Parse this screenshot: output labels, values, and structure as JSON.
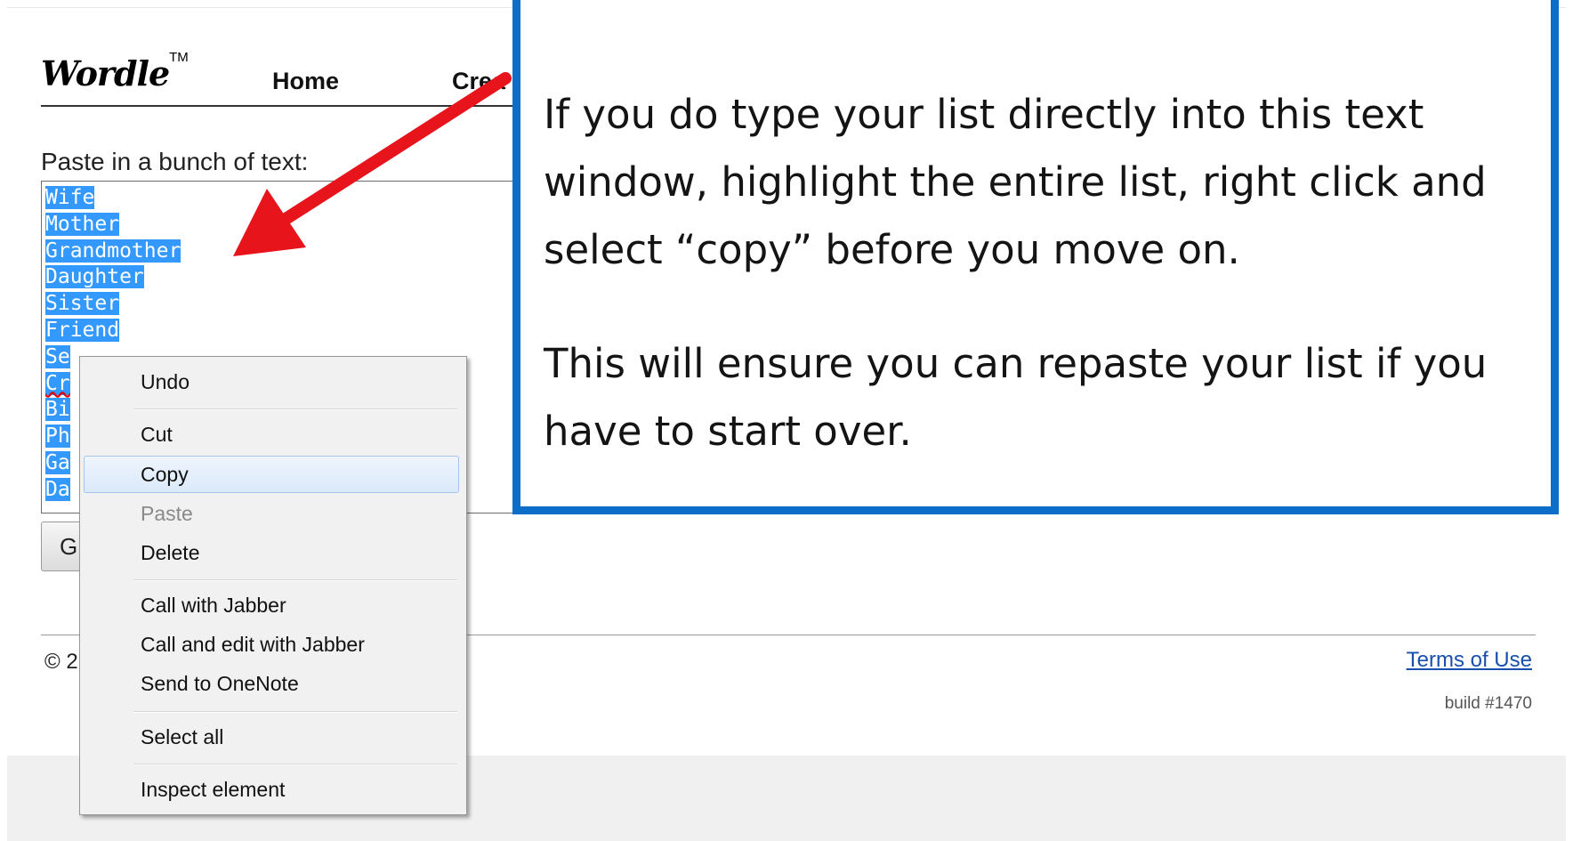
{
  "header": {
    "logo_text": "Wordle",
    "logo_tm": "TM",
    "nav_home": "Home",
    "nav_create": "Crea"
  },
  "form": {
    "paste_label": "Paste in a bunch of text:",
    "text_lines": [
      "Wife",
      "Mother",
      "Grandmother",
      "Daughter",
      "Sister",
      "Friend",
      "Se",
      "Cr",
      "Bi",
      "Ph",
      "Ga",
      "Da"
    ],
    "go_button_label": "G"
  },
  "footer": {
    "copyright": "© 2",
    "terms_link": "Terms of Use",
    "build": "build #1470"
  },
  "callout": {
    "paragraph_1": "If you do type your list directly into this text window, highlight the entire list, right click and select “copy” before you move on.",
    "paragraph_2": "This will ensure you can repaste your list if you have to start over.",
    "border_color": "#0c6ec9"
  },
  "context_menu": {
    "items": [
      {
        "label": "Undo",
        "enabled": true
      },
      {
        "label": "Cut",
        "enabled": true
      },
      {
        "label": "Copy",
        "enabled": true,
        "highlighted": true
      },
      {
        "label": "Paste",
        "enabled": false
      },
      {
        "label": "Delete",
        "enabled": true
      },
      {
        "label": "Call with Jabber",
        "enabled": true
      },
      {
        "label": "Call and edit with Jabber",
        "enabled": true
      },
      {
        "label": "Send to OneNote",
        "enabled": true
      },
      {
        "label": "Select all",
        "enabled": true
      },
      {
        "label": "Inspect element",
        "enabled": true
      }
    ]
  },
  "colors": {
    "selection": "#3399ff",
    "arrow": "#e8141c",
    "link": "#1a4fae"
  },
  "icons": {
    "arrow": "pointer-arrow-icon"
  }
}
